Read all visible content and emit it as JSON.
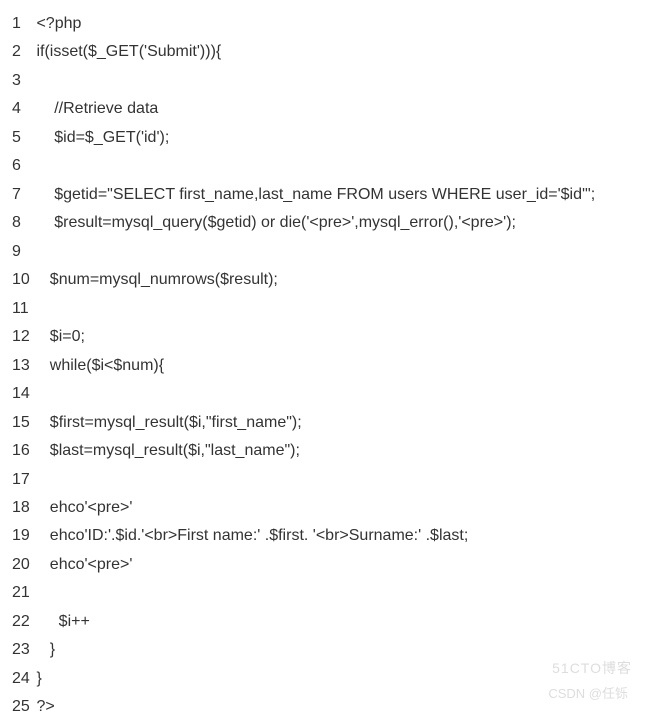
{
  "lines": [
    {
      "num": "1",
      "text": "<?php"
    },
    {
      "num": "2",
      "text": "if(isset($_GET('Submit'))){"
    },
    {
      "num": "3",
      "text": ""
    },
    {
      "num": "4",
      "text": "    //Retrieve data"
    },
    {
      "num": "5",
      "text": "    $id=$_GET('id');"
    },
    {
      "num": "6",
      "text": ""
    },
    {
      "num": "7",
      "text": "    $getid=\"SELECT first_name,last_name FROM users WHERE user_id='$id'\";"
    },
    {
      "num": "8",
      "text": "    $result=mysql_query($getid) or die('<pre>',mysql_error(),'<pre>');"
    },
    {
      "num": "9",
      "text": ""
    },
    {
      "num": "10",
      "text": "   $num=mysql_numrows($result);"
    },
    {
      "num": "11",
      "text": ""
    },
    {
      "num": "12",
      "text": "   $i=0;"
    },
    {
      "num": "13",
      "text": "   while($i<$num){"
    },
    {
      "num": "14",
      "text": ""
    },
    {
      "num": "15",
      "text": "   $first=mysql_result($i,\"first_name\");"
    },
    {
      "num": "16",
      "text": "   $last=mysql_result($i,\"last_name\");"
    },
    {
      "num": "17",
      "text": ""
    },
    {
      "num": "18",
      "text": "   ehco'<pre>'"
    },
    {
      "num": "19",
      "text": "   ehco'ID:'.$id.'<br>First name:' .$first. '<br>Surname:' .$last;"
    },
    {
      "num": "20",
      "text": "   ehco'<pre>'"
    },
    {
      "num": "21",
      "text": ""
    },
    {
      "num": "22",
      "text": "     $i++"
    },
    {
      "num": "23",
      "text": "   }"
    },
    {
      "num": "24",
      "text": "}"
    },
    {
      "num": "25",
      "text": "?>"
    }
  ],
  "watermark1": "51CTO博客",
  "watermark2": "CSDN @任铄"
}
